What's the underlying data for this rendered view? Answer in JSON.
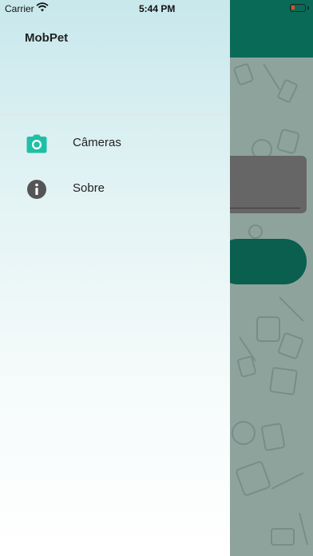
{
  "status_bar": {
    "carrier": "Carrier",
    "time": "5:44 PM",
    "battery_color": "#e0502a"
  },
  "drawer": {
    "app_title": "MobPet",
    "items": [
      {
        "label": "Câmeras",
        "icon": "camera-icon",
        "icon_color": "#1fbfa6"
      },
      {
        "label": "Sobre",
        "icon": "info-icon",
        "icon_color": "#555555"
      }
    ]
  },
  "colors": {
    "header": "#0a6a58",
    "accent": "#1fbfa6"
  }
}
